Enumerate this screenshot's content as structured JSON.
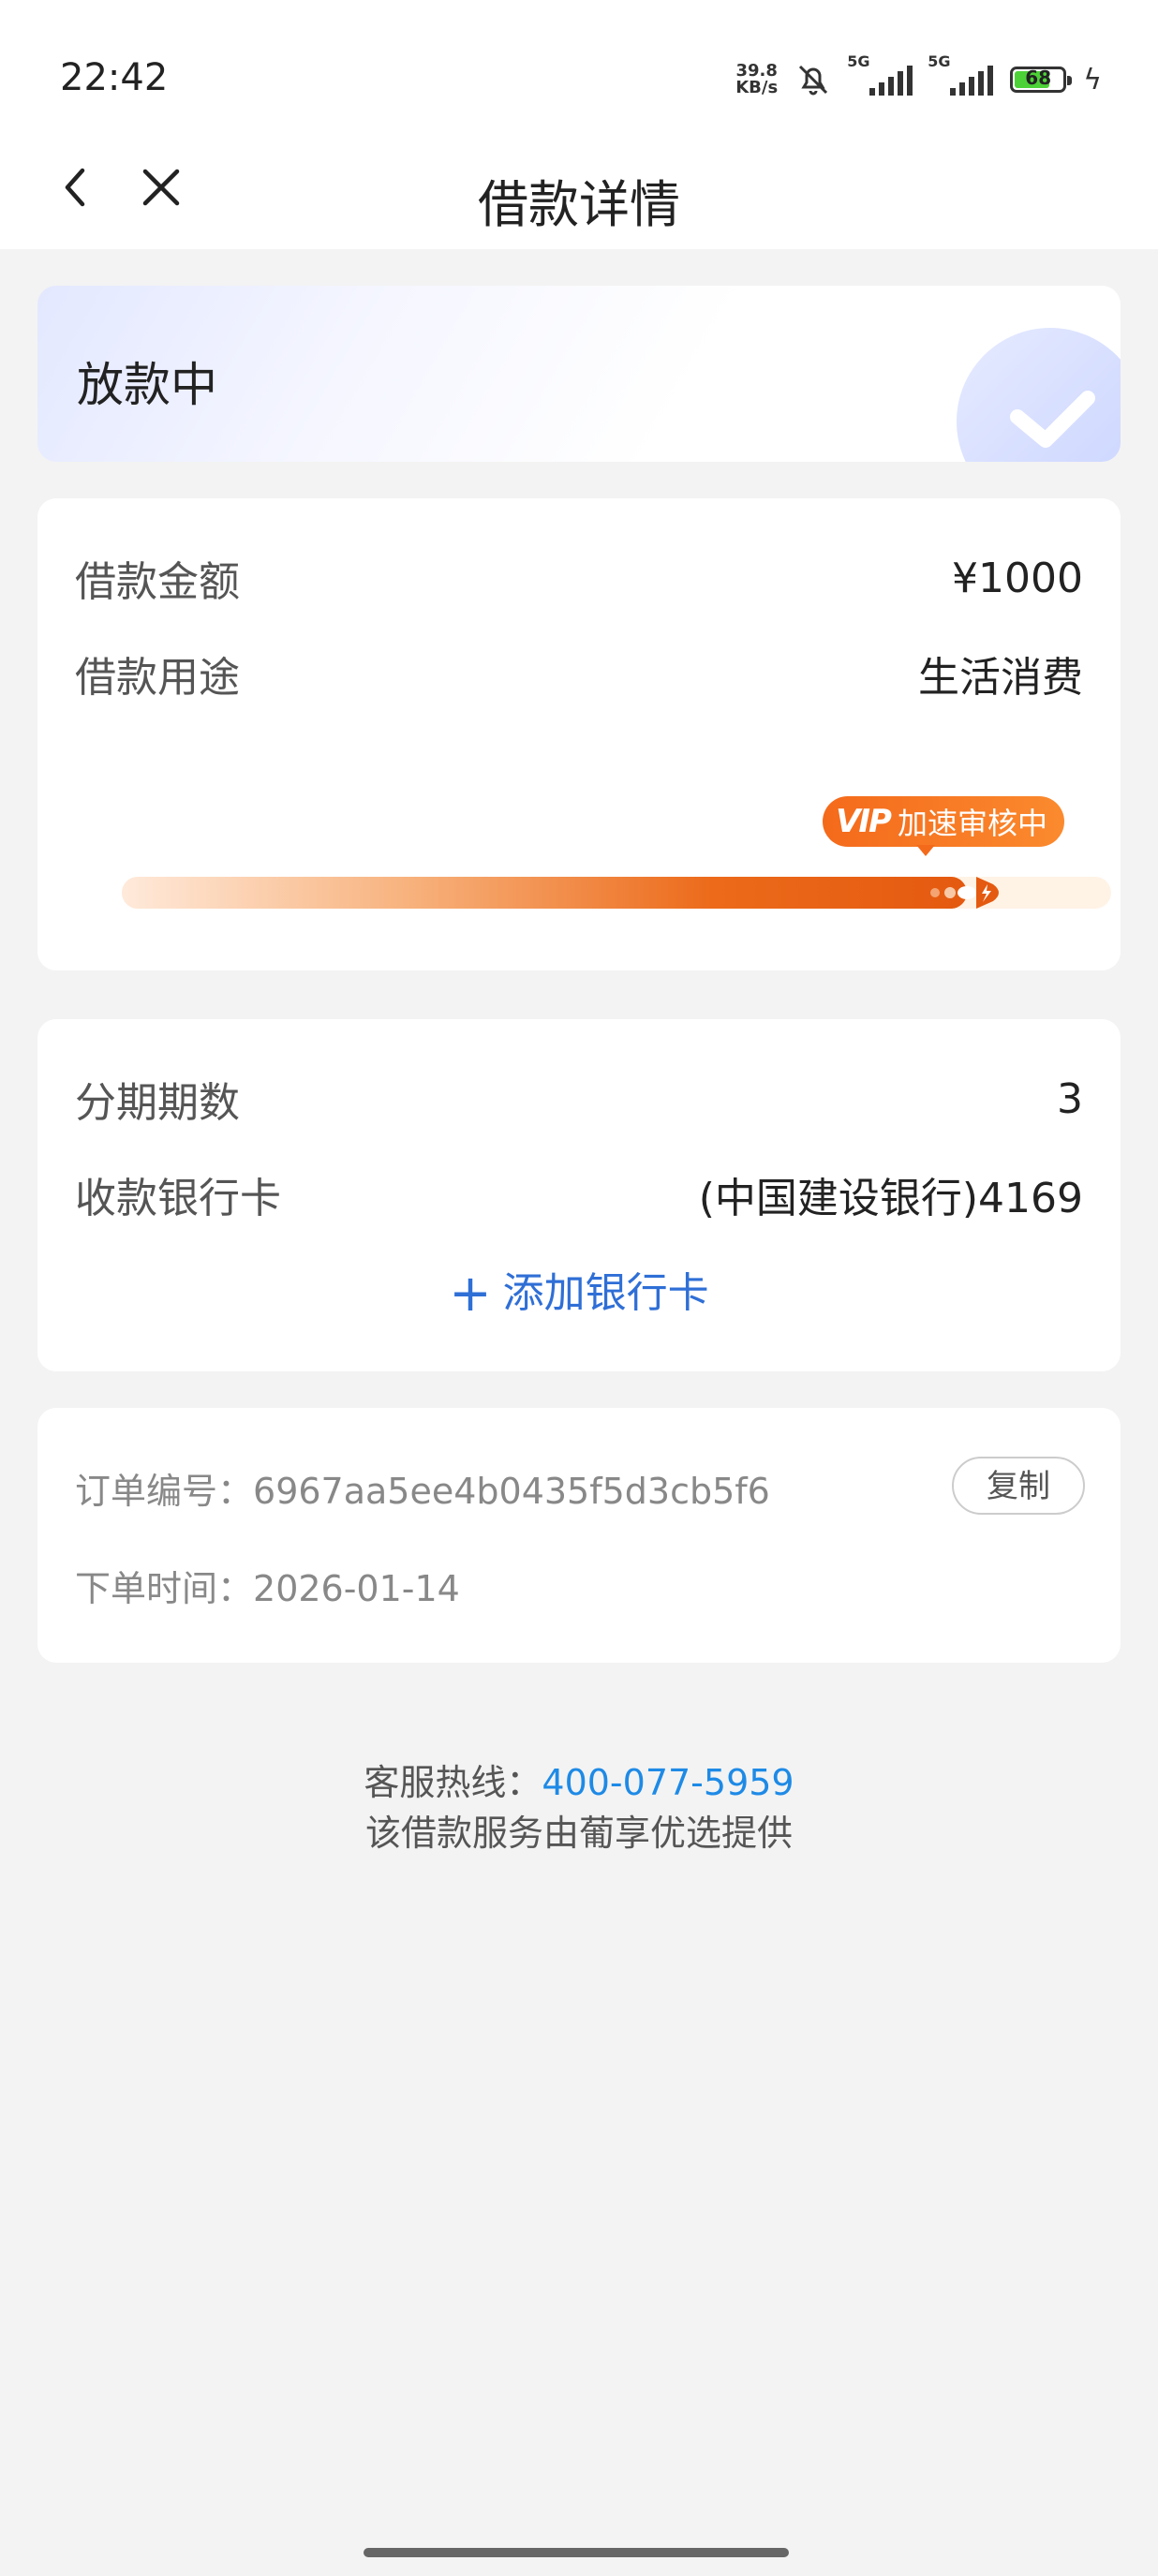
{
  "status_bar": {
    "time": "22:42",
    "net_speed_value": "39.8",
    "net_speed_unit": "KB/s",
    "signal_1_tag": "5G",
    "signal_2_tag": "5G",
    "battery_level": "68",
    "icons": [
      "bell-muted-icon",
      "signal-icon",
      "signal-icon",
      "battery-icon",
      "charging-icon"
    ]
  },
  "nav": {
    "title": "借款详情",
    "back_icon": "chevron-left-icon",
    "close_icon": "close-icon"
  },
  "status_card": {
    "status": "放款中"
  },
  "loan": {
    "amount_label": "借款金额",
    "amount_value": "¥1000",
    "purpose_label": "借款用途",
    "purpose_value": "生活消费",
    "badge_mark": "VIP",
    "badge_text": "加速审核中",
    "progress_fraction": 0.92,
    "accent_color": "#ec6a1a"
  },
  "installment": {
    "periods_label": "分期期数",
    "periods_value": "3",
    "bank_label": "收款银行卡",
    "bank_value": "(中国建设银行)4169",
    "add_card_plus": "+",
    "add_card_label": "添加银行卡",
    "link_color": "#2f6fd6"
  },
  "order": {
    "id_label": "订单编号：",
    "id_value": "6967aa5ee4b0435f5d3cb5f6",
    "copy_label": "复制",
    "time_label": "下单时间：",
    "time_value": "2026-01-14"
  },
  "footer": {
    "hotline_label": "客服热线：",
    "hotline_number": "400-077-5959",
    "provider_text": "该借款服务由葡享优选提供",
    "hotline_color": "#1e8ae6"
  }
}
